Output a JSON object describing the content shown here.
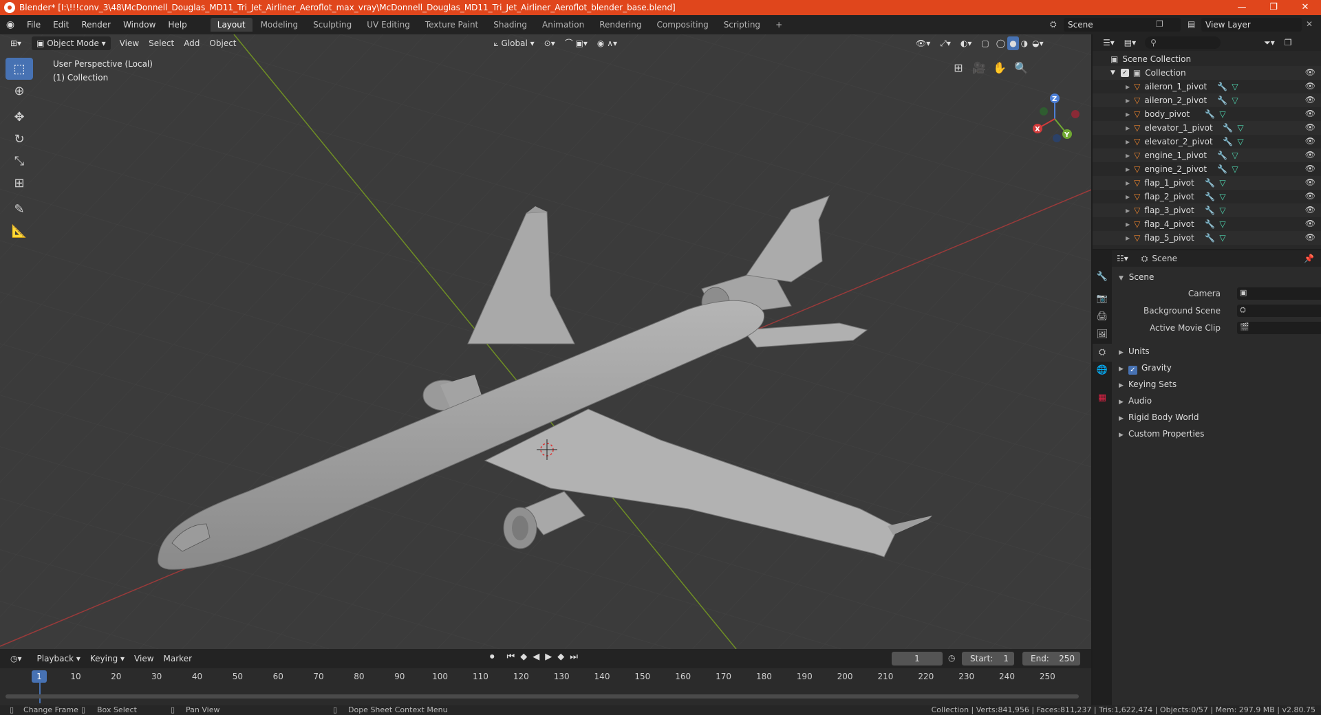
{
  "window": {
    "title": "Blender* [I:\\!!!conv_3\\48\\McDonnell_Douglas_MD11_Tri_Jet_Airliner_Aeroflot_max_vray\\McDonnell_Douglas_MD11_Tri_Jet_Airliner_Aeroflot_blender_base.blend]",
    "minimize": "—",
    "maximize": "❐",
    "close": "✕"
  },
  "menu": [
    "File",
    "Edit",
    "Render",
    "Window",
    "Help"
  ],
  "workspaces": [
    "Layout",
    "Modeling",
    "Sculpting",
    "UV Editing",
    "Texture Paint",
    "Shading",
    "Animation",
    "Rendering",
    "Compositing",
    "Scripting"
  ],
  "active_workspace": "Layout",
  "add_workspace": "+",
  "scene_name": "Scene",
  "view_layer": "View Layer",
  "viewport": {
    "mode": "Object Mode",
    "menus": [
      "View",
      "Select",
      "Add",
      "Object"
    ],
    "orientation": "Global",
    "perspective": "User Perspective (Local)",
    "collection": "(1) Collection",
    "gizmo": {
      "x": "X",
      "y": "Y",
      "z": "Z"
    }
  },
  "outliner": {
    "scene_collection": "Scene Collection",
    "collection": "Collection",
    "items": [
      "aileron_1_pivot",
      "aileron_2_pivot",
      "body_pivot",
      "elevator_1_pivot",
      "elevator_2_pivot",
      "engine_1_pivot",
      "engine_2_pivot",
      "flap_1_pivot",
      "flap_2_pivot",
      "flap_3_pivot",
      "flap_4_pivot",
      "flap_5_pivot"
    ]
  },
  "properties": {
    "header": "Scene",
    "panel": "Scene",
    "fields": [
      {
        "label": "Camera"
      },
      {
        "label": "Background Scene"
      },
      {
        "label": "Active Movie Clip"
      }
    ],
    "subpanels": [
      "Units",
      "Gravity",
      "Keying Sets",
      "Audio",
      "Rigid Body World",
      "Custom Properties"
    ],
    "gravity_checked": true
  },
  "timeline": {
    "menus": [
      "Playback",
      "Keying",
      "View",
      "Marker"
    ],
    "current_frame": "1",
    "start_label": "Start:",
    "start": "1",
    "end_label": "End:",
    "end": "250",
    "ticks": [
      "10",
      "20",
      "30",
      "40",
      "50",
      "60",
      "70",
      "80",
      "90",
      "100",
      "110",
      "120",
      "130",
      "140",
      "150",
      "160",
      "170",
      "180",
      "190",
      "200",
      "210",
      "220",
      "230",
      "240",
      "250"
    ]
  },
  "status": {
    "change_frame": "Change Frame",
    "box_select": "Box Select",
    "pan_view": "Pan View",
    "context_menu": "Dope Sheet Context Menu",
    "stats": "Collection | Verts:841,956 | Faces:811,237 | Tris:1,622,474 | Objects:0/57 | Mem: 297.9 MB | v2.80.75"
  }
}
